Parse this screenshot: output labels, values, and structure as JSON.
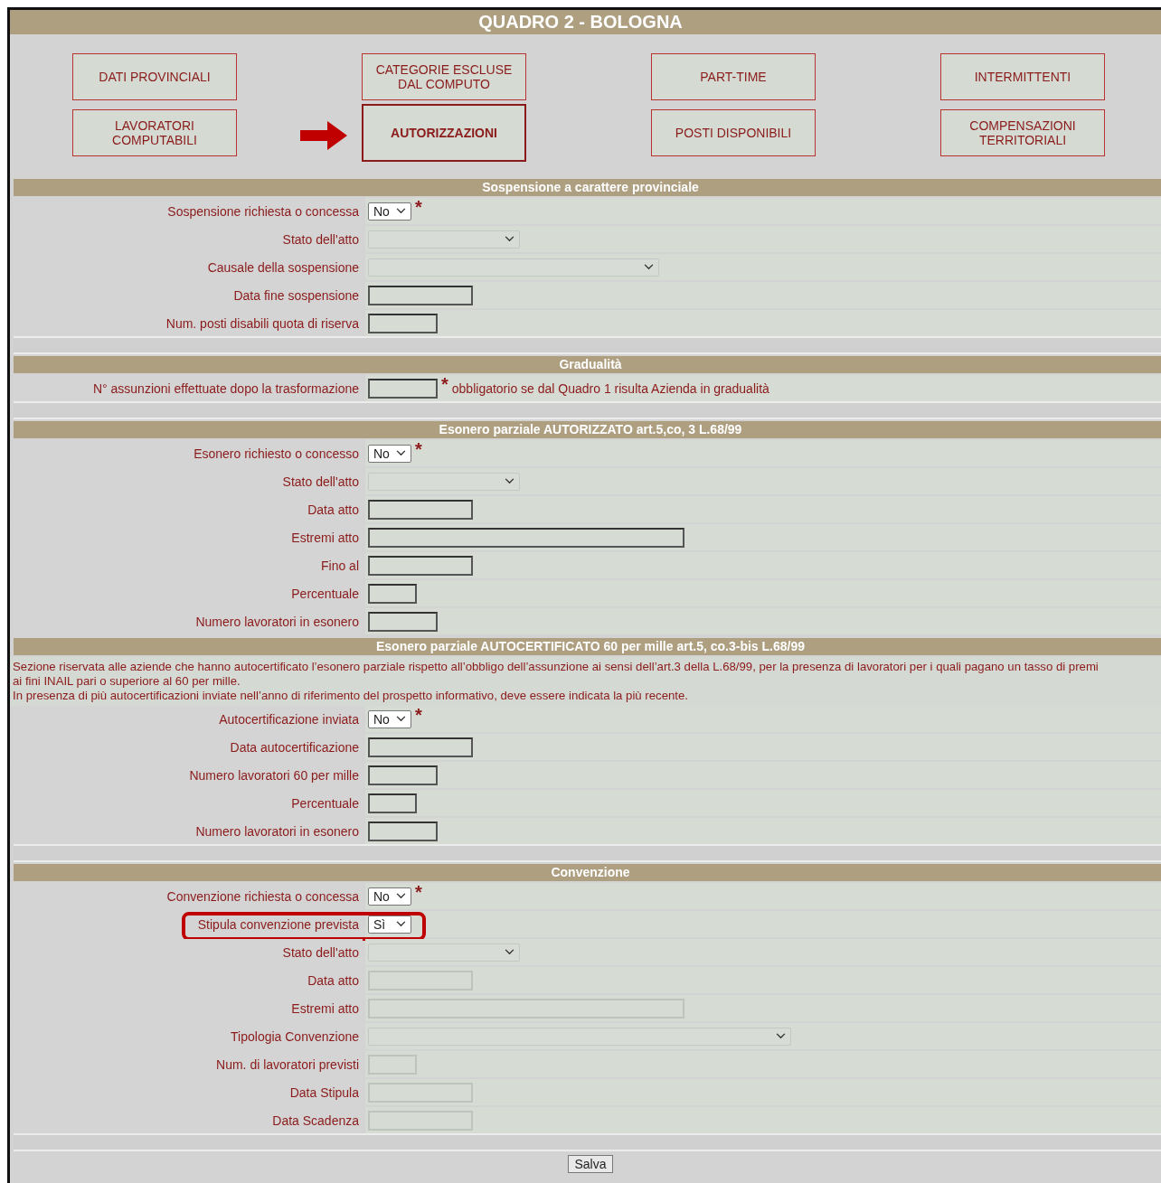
{
  "title": "QUADRO 2 - BOLOGNA",
  "nav": [
    {
      "label": "DATI PROVINCIALI",
      "selected": false
    },
    {
      "label": "CATEGORIE ESCLUSE\nDAL COMPUTO",
      "selected": false
    },
    {
      "label": "PART-TIME",
      "selected": false
    },
    {
      "label": "INTERMITTENTI",
      "selected": false
    },
    {
      "label": "LAVORATORI\nCOMPUTABILI",
      "selected": false
    },
    {
      "label": "AUTORIZZAZIONI",
      "selected": true
    },
    {
      "label": "POSTI DISPONIBILI",
      "selected": false
    },
    {
      "label": "COMPENSAZIONI\nTERRITORIALI",
      "selected": false
    }
  ],
  "sections": [
    {
      "title": "Sospensione a carattere provinciale",
      "blank_row": true,
      "rows": [
        {
          "label": "Sospensione richiesta o concessa",
          "kind": "choice",
          "value": "No",
          "disabled": false,
          "required": "*"
        },
        {
          "label": "Stato dell'atto",
          "kind": "list",
          "disabled": true
        },
        {
          "label": "Causale della sospensione",
          "kind": "wide-list",
          "disabled": true
        },
        {
          "label": "Data fine sospensione",
          "kind": "date",
          "disabled": false
        },
        {
          "label": "Num. posti disabili quota di riserva",
          "kind": "number",
          "disabled": false
        }
      ]
    },
    {
      "title": "Gradualità",
      "blank_row": true,
      "rows": [
        {
          "label": "N° assunzioni effettuate dopo la trasformazione",
          "kind": "number",
          "disabled": false,
          "required": "*",
          "note": "obbligatorio se dal Quadro 1 risulta Azienda in gradualità"
        }
      ]
    },
    {
      "title": "Esonero parziale AUTORIZZATO art.5,co, 3 L.68/99",
      "rows": [
        {
          "label": "Esonero richiesto o concesso",
          "kind": "choice",
          "value": "No",
          "disabled": false,
          "required": "*"
        },
        {
          "label": "Stato dell'atto",
          "kind": "list",
          "disabled": true
        },
        {
          "label": "Data atto",
          "kind": "date",
          "disabled": false
        },
        {
          "label": "Estremi atto",
          "kind": "long",
          "disabled": false
        },
        {
          "label": "Fino al",
          "kind": "date",
          "disabled": false
        },
        {
          "label": "Percentuale",
          "kind": "short",
          "disabled": false
        },
        {
          "label": "Numero lavoratori in esonero",
          "kind": "number",
          "disabled": false
        }
      ]
    },
    {
      "title": "Esonero parziale AUTOCERTIFICATO 60 per mille art.5, co.3-bis L.68/99",
      "blank_row": true,
      "description": [
        "Sezione riservata alle aziende che hanno autocertificato l’esonero parziale rispetto all’obbligo dell’assunzione ai sensi dell’art.3 della L.68/99, per la presenza di lavoratori per i quali pagano un tasso di premi",
        "ai fini INAIL pari o superiore al 60 per mille.",
        "In presenza di più autocertificazioni inviate nell’anno di riferimento del prospetto informativo, deve essere indicata la più recente."
      ],
      "rows": [
        {
          "label": "Autocertificazione inviata",
          "kind": "choice",
          "value": "No",
          "disabled": false,
          "required": "*"
        },
        {
          "label": "Data autocertificazione",
          "kind": "date",
          "disabled": false
        },
        {
          "label": "Numero lavoratori 60 per mille",
          "kind": "number",
          "disabled": false
        },
        {
          "label": "Percentuale",
          "kind": "short",
          "disabled": false
        },
        {
          "label": "Numero lavoratori in esonero",
          "kind": "number",
          "disabled": false
        }
      ]
    },
    {
      "title": "Convenzione",
      "blank_row": true,
      "rows": [
        {
          "label": "Convenzione richiesta o concessa",
          "kind": "choice",
          "value": "No",
          "disabled": false,
          "required": "*"
        },
        {
          "label": "Stipula convenzione prevista",
          "kind": "choice",
          "value": "Sì",
          "disabled": false,
          "highlighted": true
        },
        {
          "label": "Stato dell'atto",
          "kind": "list",
          "disabled": true
        },
        {
          "label": "Data atto",
          "kind": "date",
          "disabled": true
        },
        {
          "label": "Estremi atto",
          "kind": "long",
          "disabled": true
        },
        {
          "label": "Tipologia Convenzione",
          "kind": "xwide-list",
          "disabled": true
        },
        {
          "label": "Num. di lavoratori previsti",
          "kind": "short",
          "disabled": true
        },
        {
          "label": "Data Stipula",
          "kind": "date",
          "disabled": true
        },
        {
          "label": "Data Scadenza",
          "kind": "date",
          "disabled": true
        }
      ]
    }
  ],
  "save_button": "Salva"
}
